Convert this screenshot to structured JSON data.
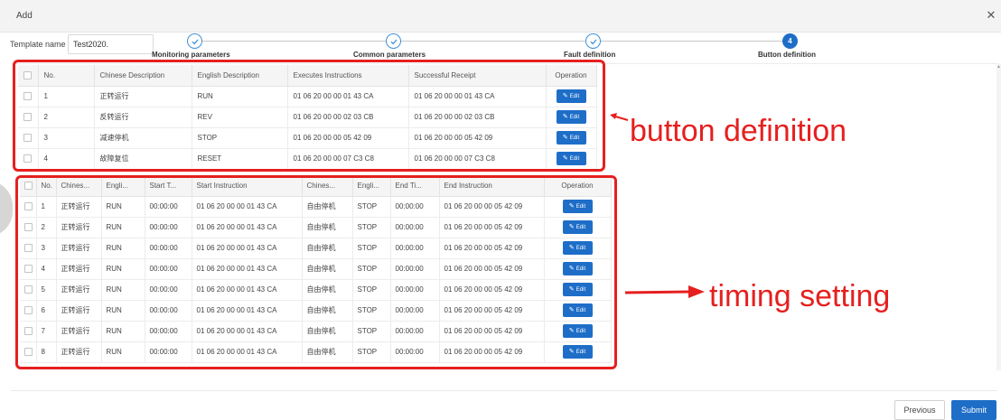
{
  "dialog": {
    "title": "Add",
    "close_icon": "close-icon"
  },
  "template": {
    "label": "Template name",
    "value": "Test2020."
  },
  "steps": [
    {
      "label": "Monitoring parameters",
      "status": "done",
      "icon": "check-icon"
    },
    {
      "label": "Common parameters",
      "status": "done",
      "icon": "check-icon"
    },
    {
      "label": "Fault definition",
      "status": "done",
      "icon": "check-icon"
    },
    {
      "label": "Button definition",
      "status": "active",
      "number": "4"
    }
  ],
  "button_table": {
    "columns": [
      "No.",
      "Chinese Description",
      "English Description",
      "Executes Instructions",
      "Successful Receipt",
      "Operation"
    ],
    "rows": [
      {
        "no": "1",
        "cn": "正转运行",
        "en": "RUN",
        "exec": "01 06 20 00 00 01 43 CA",
        "receipt": "01 06 20 00 00 01 43 CA"
      },
      {
        "no": "2",
        "cn": "反转运行",
        "en": "REV",
        "exec": "01 06 20 00 00 02 03 CB",
        "receipt": "01 06 20 00 00 02 03 CB"
      },
      {
        "no": "3",
        "cn": "减速停机",
        "en": "STOP",
        "exec": "01 06 20 00 00 05 42 09",
        "receipt": "01 06 20 00 00 05 42 09"
      },
      {
        "no": "4",
        "cn": "故障复位",
        "en": "RESET",
        "exec": "01 06 20 00 00 07 C3 C8",
        "receipt": "01 06 20 00 00 07 C3 C8"
      }
    ],
    "edit_label": "Edit"
  },
  "timing_table": {
    "columns": [
      "No.",
      "Chines...",
      "Engli...",
      "Start T...",
      "Start Instruction",
      "Chines...",
      "Engli...",
      "End Ti...",
      "End Instruction",
      "Operation"
    ],
    "rows": [
      {
        "no": "1",
        "cn1": "正转运行",
        "en1": "RUN",
        "start_time": "00:00:00",
        "start_instr": "01 06 20 00 00 01 43 CA",
        "cn2": "自由停机",
        "en2": "STOP",
        "end_time": "00:00:00",
        "end_instr": "01 06 20 00 00 05 42 09"
      },
      {
        "no": "2",
        "cn1": "正转运行",
        "en1": "RUN",
        "start_time": "00:00:00",
        "start_instr": "01 06 20 00 00 01 43 CA",
        "cn2": "自由停机",
        "en2": "STOP",
        "end_time": "00:00:00",
        "end_instr": "01 06 20 00 00 05 42 09"
      },
      {
        "no": "3",
        "cn1": "正转运行",
        "en1": "RUN",
        "start_time": "00:00:00",
        "start_instr": "01 06 20 00 00 01 43 CA",
        "cn2": "自由停机",
        "en2": "STOP",
        "end_time": "00:00:00",
        "end_instr": "01 06 20 00 00 05 42 09"
      },
      {
        "no": "4",
        "cn1": "正转运行",
        "en1": "RUN",
        "start_time": "00:00:00",
        "start_instr": "01 06 20 00 00 01 43 CA",
        "cn2": "自由停机",
        "en2": "STOP",
        "end_time": "00:00:00",
        "end_instr": "01 06 20 00 00 05 42 09"
      },
      {
        "no": "5",
        "cn1": "正转运行",
        "en1": "RUN",
        "start_time": "00:00:00",
        "start_instr": "01 06 20 00 00 01 43 CA",
        "cn2": "自由停机",
        "en2": "STOP",
        "end_time": "00:00:00",
        "end_instr": "01 06 20 00 00 05 42 09"
      },
      {
        "no": "6",
        "cn1": "正转运行",
        "en1": "RUN",
        "start_time": "00:00:00",
        "start_instr": "01 06 20 00 00 01 43 CA",
        "cn2": "自由停机",
        "en2": "STOP",
        "end_time": "00:00:00",
        "end_instr": "01 06 20 00 00 05 42 09"
      },
      {
        "no": "7",
        "cn1": "正转运行",
        "en1": "RUN",
        "start_time": "00:00:00",
        "start_instr": "01 06 20 00 00 01 43 CA",
        "cn2": "自由停机",
        "en2": "STOP",
        "end_time": "00:00:00",
        "end_instr": "01 06 20 00 00 05 42 09"
      },
      {
        "no": "8",
        "cn1": "正转运行",
        "en1": "RUN",
        "start_time": "00:00:00",
        "start_instr": "01 06 20 00 00 01 43 CA",
        "cn2": "自由停机",
        "en2": "STOP",
        "end_time": "00:00:00",
        "end_instr": "01 06 20 00 00 05 42 09"
      }
    ],
    "edit_label": "Edit"
  },
  "annotations": {
    "button_definition": "button definition",
    "timing_setting": "timing setting",
    "color": "#e5201f"
  },
  "footer": {
    "previous_label": "Previous",
    "submit_label": "Submit"
  },
  "colors": {
    "primary": "#1e6ec8",
    "header_bg": "#f3f3f3"
  }
}
